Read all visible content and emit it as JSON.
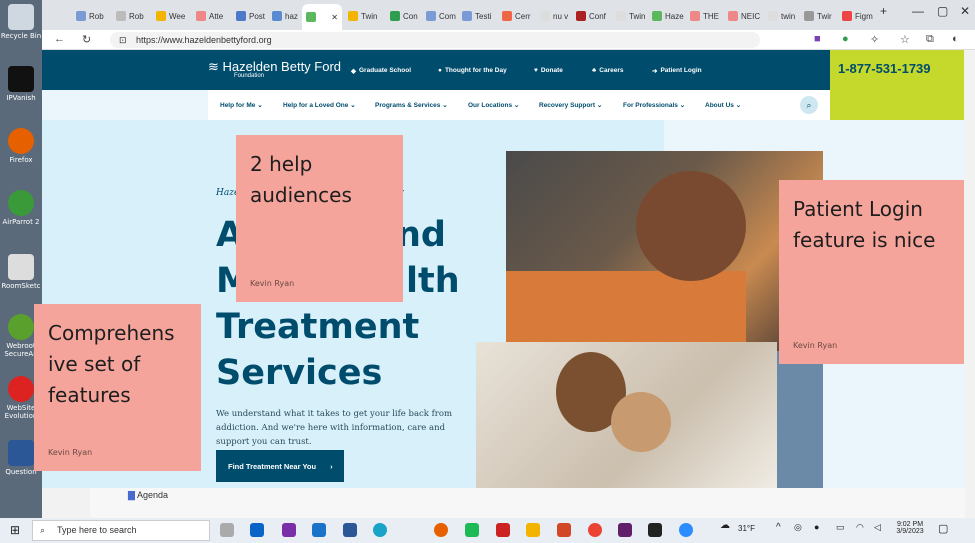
{
  "desktop": {
    "icons": [
      "Recycle Bin",
      "IPVanish",
      "Firefox",
      "AirParrot 2",
      "RoomSketc",
      "Webroot SecureAn",
      "WebSite Evolution",
      "Question"
    ]
  },
  "browser": {
    "tabs": [
      "Rob",
      "Rob",
      "Wee",
      "Atte",
      "Post",
      "haz",
      "",
      "Twin",
      "Con",
      "Com",
      "Testi",
      "Cerr",
      "nu v",
      "Conf",
      "Twin",
      "Haze",
      "THE",
      "NEIC",
      "twin",
      "Twir",
      "Figm"
    ],
    "new_tab": "+",
    "window_controls": [
      "—",
      "▢",
      "✕"
    ],
    "url": "https://www.hazeldenbettyford.org"
  },
  "site": {
    "logo": "Hazelden Betty Ford",
    "logo_sub": "Foundation",
    "top_links": [
      "Graduate School",
      "Thought for the Day",
      "Donate",
      "Careers",
      "Patient Login"
    ],
    "phone": "1-877-531-1739",
    "nav": [
      "Help for Me",
      "Help for a Loved One",
      "Programs & Services",
      "Our Locations",
      "Recovery Support",
      "For Professionals",
      "About Us"
    ],
    "kicker_left": "Haze",
    "kicker_right": "der",
    "headline": [
      {
        "left": "A",
        "right": "nd"
      },
      {
        "left": "M",
        "right": "lth"
      },
      {
        "left": "Treatment",
        "right": ""
      },
      {
        "left": "Services",
        "right": ""
      }
    ],
    "subtext": "We understand what it takes to get your life back from addiction. And we're here with information, care and support you can trust.",
    "cta": "Find Treatment Near You",
    "cta_arrow": "›"
  },
  "stickies": [
    {
      "text": "2 help audiences",
      "author": "Kevin Ryan"
    },
    {
      "text": "Patient Login feature is nice",
      "author": "Kevin Ryan"
    },
    {
      "text": "Comprehens ive set of features",
      "author": "Kevin Ryan"
    }
  ],
  "below": {
    "agenda": "Agenda"
  },
  "taskbar": {
    "search_placeholder": "Type here to search",
    "weather": "31°F",
    "time": "9:02 PM",
    "date": "3/9/2023"
  },
  "colors": {
    "brand_navy": "#004c6d",
    "brand_lime": "#c5d92d",
    "sticky": "#f4a49a",
    "hero_bg": "#d7f0fa"
  }
}
